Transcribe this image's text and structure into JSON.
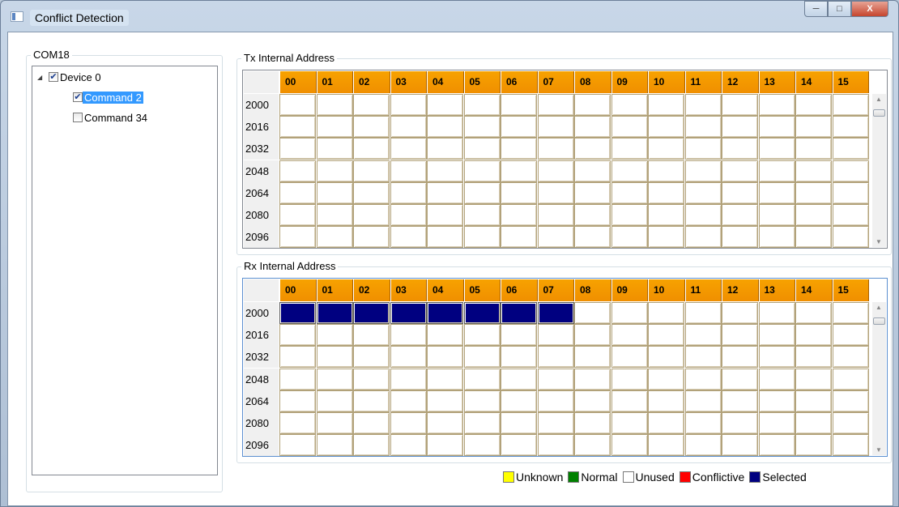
{
  "window": {
    "title": "Conflict Detection",
    "controls": {
      "minimize": "─",
      "maximize": "□",
      "close": "X"
    }
  },
  "port_group": {
    "label": "COM18",
    "tree": [
      {
        "label": "Device 0",
        "expander": "◢",
        "checked": true,
        "level": 0,
        "selected": false
      },
      {
        "label": "Command 2",
        "checked": true,
        "level": 1,
        "selected": true
      },
      {
        "label": "Command 34",
        "checked": false,
        "level": 1,
        "selected": false
      }
    ]
  },
  "tx": {
    "label": "Tx Internal Address",
    "columns": [
      "00",
      "01",
      "02",
      "03",
      "04",
      "05",
      "06",
      "07",
      "08",
      "09",
      "10",
      "11",
      "12",
      "13",
      "14",
      "15"
    ],
    "rows": [
      "2000",
      "2016",
      "2032",
      "2048",
      "2064",
      "2080",
      "2096"
    ],
    "selected_cells": []
  },
  "rx": {
    "label": "Rx Internal Address",
    "columns": [
      "00",
      "01",
      "02",
      "03",
      "04",
      "05",
      "06",
      "07",
      "08",
      "09",
      "10",
      "11",
      "12",
      "13",
      "14",
      "15"
    ],
    "rows": [
      "2000",
      "2016",
      "2032",
      "2048",
      "2064",
      "2080",
      "2096"
    ],
    "selected_cells": [
      [
        0,
        0
      ],
      [
        0,
        1
      ],
      [
        0,
        2
      ],
      [
        0,
        3
      ],
      [
        0,
        4
      ],
      [
        0,
        5
      ],
      [
        0,
        6
      ],
      [
        0,
        7
      ]
    ]
  },
  "legend": [
    {
      "label": "Unknown",
      "color": "#ffff00"
    },
    {
      "label": "Normal",
      "color": "#008000"
    },
    {
      "label": "Unused",
      "color": "#ffffff"
    },
    {
      "label": "Conflictive",
      "color": "#ff0000"
    },
    {
      "label": "Selected",
      "color": "#000080"
    }
  ]
}
